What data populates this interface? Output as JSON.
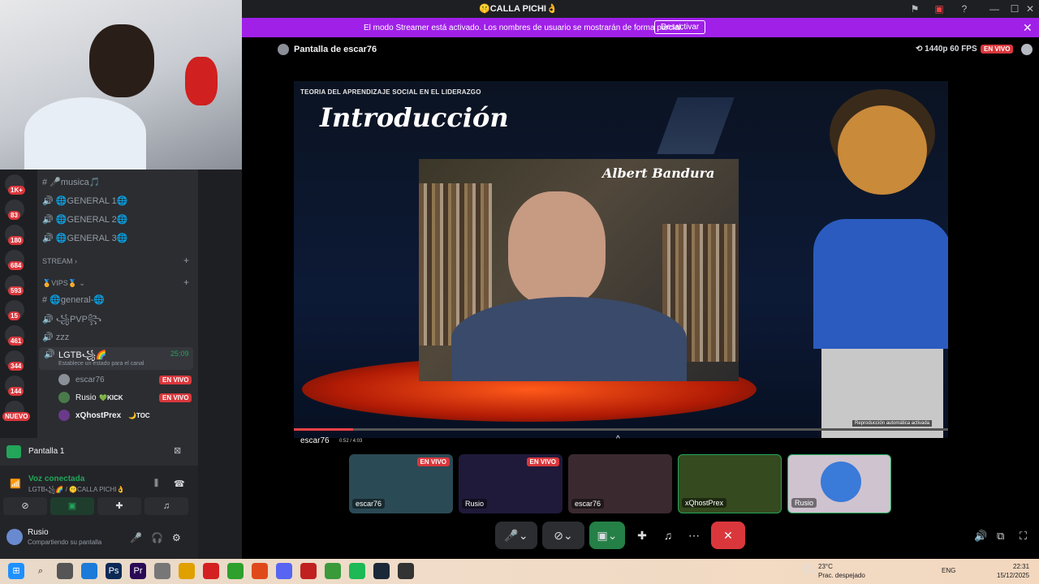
{
  "window": {
    "title": "🤫CALLA PICHI👌",
    "controls": [
      "⚑",
      "▣",
      "?",
      "—",
      "☐",
      "✕"
    ]
  },
  "banner": {
    "text": "El modo Streamer está activado. Los nombres de usuario se mostrarán de forma parcial.",
    "button": "Desactivar",
    "close": "✕"
  },
  "stage": {
    "screen_title": "Pantalla de escar76",
    "quality": "⟲ 1440p 60 FPS",
    "live": "EN VIVO",
    "video": {
      "slide_subtitle": "TEORIA DEL APRENDIZAJE SOCIAL EN EL LIDERAZGO",
      "slide_title": "Introducción",
      "inset_name": "Albert Bandura",
      "autoplay_note": "Reproducción automática activada",
      "time": "0:52 / 4:03",
      "progress_fraction": 0.09,
      "overlay_user": "escar76"
    },
    "tiles": [
      {
        "label": "escar76",
        "live": "EN VIVO",
        "bg": "#2a4a55"
      },
      {
        "label": "Rusio",
        "live": "EN VIVO",
        "bg": "#1f1a3a"
      },
      {
        "label": "escar76",
        "live": "",
        "bg": "#3a2a30"
      },
      {
        "label": "xQhostPrex",
        "live": "",
        "bg": "#354a1e"
      },
      {
        "label": "Rusio",
        "live": "",
        "bg": "#cfc3cf"
      }
    ],
    "controls_icons": [
      "mic-icon",
      "camera-off-icon",
      "screen-share-icon",
      "activities-icon",
      "soundboard-icon",
      "more-icon",
      "disconnect-icon"
    ]
  },
  "servers": [
    {
      "count": "1K+"
    },
    {
      "count": "83"
    },
    {
      "count": "180"
    },
    {
      "count": "684"
    },
    {
      "count": "593"
    },
    {
      "count": "15"
    },
    {
      "count": "461"
    },
    {
      "count": "344"
    },
    {
      "count": "144"
    },
    {
      "count": "NUEVO"
    }
  ],
  "channels": {
    "musica": "🎤musica🎵",
    "general1": "🌐GENERAL 1🌐",
    "general2": "🌐GENERAL 2🌐",
    "general3": "🌐GENERAL 3🌐",
    "stream_category": "STREAM",
    "vips_category": "🏅VIPS🏅",
    "general_text": "🌐general-🌐",
    "pvp": "꧁PVP꧂",
    "zzz": "zzz",
    "lgtb": "LGTB꧁🌈",
    "lgtb_time": "25:09",
    "status_hint": "Establece un estado para el canal",
    "users": [
      {
        "name": "escar76",
        "badge": "",
        "live": "EN VIVO"
      },
      {
        "name": "Rusio",
        "badge": "💚KICK",
        "live": "EN VIVO"
      },
      {
        "name": "xQhostPrex",
        "badge": "🌙TOC",
        "live": ""
      }
    ]
  },
  "panel": {
    "screen": "Pantalla 1",
    "voice_status": "Voz conectada",
    "voice_channel": "LGTB꧁🌈 / 🤫CALLA PICHI👌",
    "username": "Rusio",
    "user_status": "Compartiendo su pantalla"
  },
  "taskbar": {
    "weather_temp": "23°C",
    "weather_desc": "Prac. despejado",
    "lang": "ENG",
    "time": "22:31",
    "date": "15/12/2025"
  }
}
